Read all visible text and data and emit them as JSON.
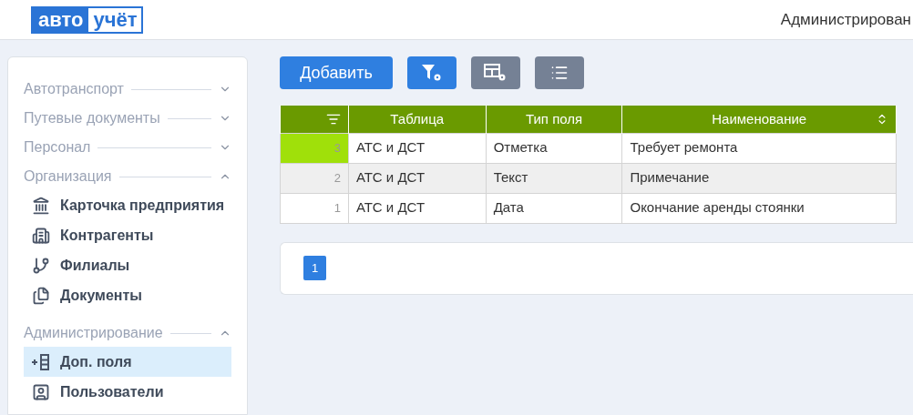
{
  "header": {
    "logo": [
      "авто",
      "учёт"
    ],
    "title": "Администрирован"
  },
  "sidebar": {
    "sections": [
      {
        "label": "Автотранспорт",
        "expanded": false
      },
      {
        "label": "Путевые документы",
        "expanded": false
      },
      {
        "label": "Персонал",
        "expanded": false
      },
      {
        "label": "Организация",
        "expanded": true,
        "items": [
          {
            "label": "Карточка предприятия",
            "selected": false
          },
          {
            "label": "Контрагенты",
            "selected": false
          },
          {
            "label": "Филиалы",
            "selected": false
          },
          {
            "label": "Документы",
            "selected": false
          }
        ]
      },
      {
        "label": "Администрирование",
        "expanded": true,
        "items": [
          {
            "label": "Доп. поля",
            "selected": true
          },
          {
            "label": "Пользователи",
            "selected": false
          }
        ]
      }
    ]
  },
  "toolbar": {
    "add_button": "Добавить"
  },
  "table": {
    "columns": [
      {},
      {
        "label": "Таблица"
      },
      {
        "label": "Тип поля"
      },
      {
        "label": "Наименование"
      }
    ],
    "rows": [
      {
        "cells": [
          "3",
          "АТС и ДСТ",
          "Отметка",
          "Требует ремонта"
        ],
        "selected": true,
        "hovered": false
      },
      {
        "cells": [
          "2",
          "АТС и ДСТ",
          "Текст",
          "Примечание"
        ],
        "selected": false,
        "hovered": true
      },
      {
        "cells": [
          "1",
          "АТС и ДСТ",
          "Дата",
          "Окончание аренды стоянки"
        ],
        "selected": false,
        "hovered": false
      }
    ]
  },
  "pagination": {
    "pages": [
      {
        "label": "1",
        "selected": true
      }
    ]
  }
}
